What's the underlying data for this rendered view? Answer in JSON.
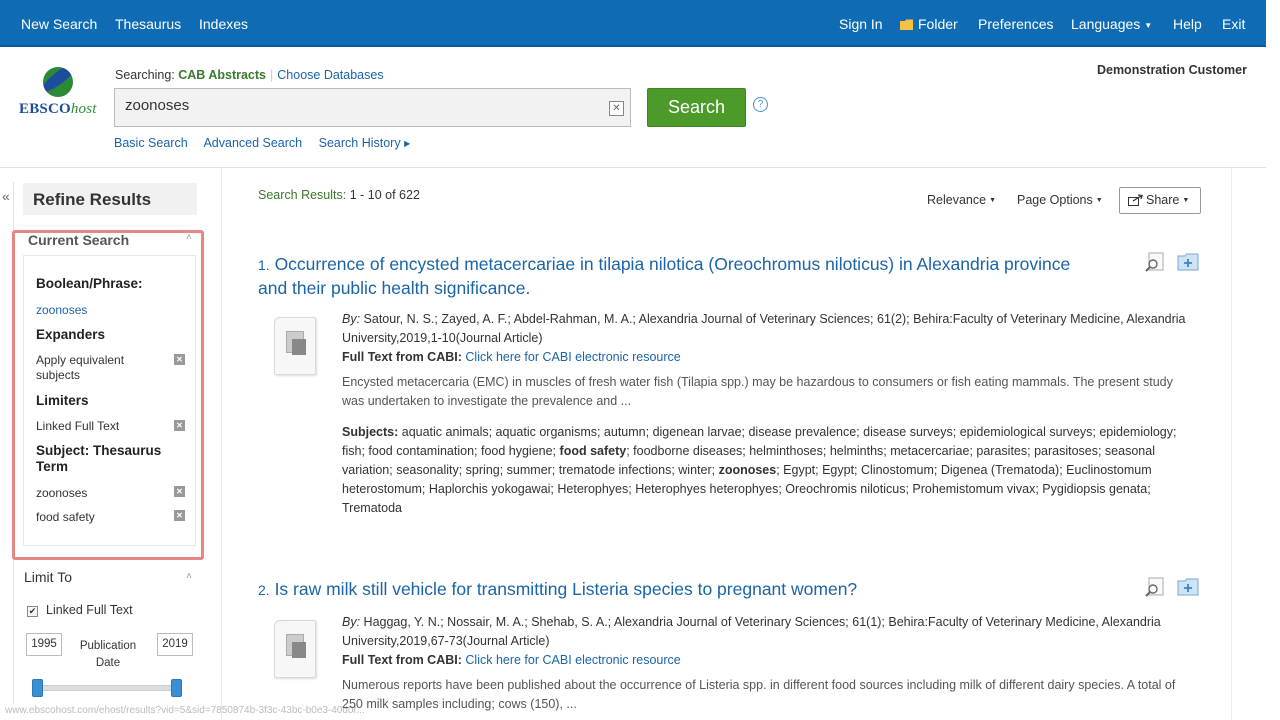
{
  "topnav": {
    "new_search": "New Search",
    "thesaurus": "Thesaurus",
    "indexes": "Indexes",
    "sign_in": "Sign In",
    "folder": "Folder",
    "preferences": "Preferences",
    "languages": "Languages",
    "help": "Help",
    "exit": "Exit"
  },
  "header": {
    "logo_main": "EBSCO",
    "logo_host": "host",
    "searching_label": "Searching:",
    "database": "CAB Abstracts",
    "choose_databases": "Choose Databases",
    "query": "zoonoses",
    "search_button": "Search",
    "help_glyph": "?",
    "basic_search": "Basic Search",
    "advanced_search": "Advanced Search",
    "search_history": "Search History",
    "customer": "Demonstration Customer"
  },
  "sidebar": {
    "refine_title": "Refine Results",
    "current_search": "Current Search",
    "boolean_label": "Boolean/Phrase:",
    "boolean_value": "zoonoses",
    "expanders_label": "Expanders",
    "expander_value": "Apply equivalent subjects",
    "limiters_label": "Limiters",
    "limiter_value": "Linked Full Text",
    "subject_label": "Subject: Thesaurus Term",
    "subject_value_1": "zoonoses",
    "subject_value_2": "food safety",
    "limit_to": "Limit To",
    "linked_full_text": "Linked Full Text",
    "linked_full_text_checked": true,
    "year_from": "1995",
    "year_to": "2019",
    "pub_date_label": "Publication Date",
    "status_url": "www.ebscohost.com/ehost/results?vid=5&sid=7850874b-3f3c-43bc-b0e3-40d0f..."
  },
  "results": {
    "count_label": "Search Results:",
    "count_value": "1 - 10 of 622",
    "relevance": "Relevance",
    "page_options": "Page Options",
    "share": "Share",
    "items": [
      {
        "num": "1.",
        "title": "Occurrence of encysted metacercariae in tilapia nilotica (Oreochromus niloticus) in Alexandria province and their public health significance.",
        "by_label": "By:",
        "byline": "Satour, N. S.; Zayed, A. F.; Abdel-Rahman, M. A.; Alexandria Journal of Veterinary Sciences; 61(2); Behira:Faculty of Veterinary Medicine, Alexandria University,2019,1-10(Journal Article)",
        "full_text_label": "Full Text from CABI:",
        "full_text_link": "Click here for CABI electronic resource",
        "abstract": "Encysted metacercaria (EMC) in muscles of fresh water fish (Tilapia spp.) may be hazardous to consumers or fish eating mammals. The present study was undertaken to investigate the prevalence and ...",
        "subjects_label": "Subjects:",
        "subjects_a": "aquatic animals; aquatic organisms; autumn; digenean larvae; disease prevalence; disease surveys; epidemiological surveys; epidemiology; fish; food contamination; food hygiene;",
        "subjects_bold1": "food safety",
        "subjects_b": "; foodborne diseases; helminthoses; helminths; metacercariae; parasites; parasitoses; seasonal variation; seasonality; spring; summer; trematode infections; winter;",
        "subjects_bold2": "zoonoses",
        "subjects_c": "; Egypt; Egypt; Clinostomum; Digenea (Trematoda); Euclinostomum heterostomum; Haplorchis yokogawai; Heterophyes; Heterophyes heterophyes; Oreochromis niloticus; Prohemistomum vivax; Pygidiopsis genata; Trematoda"
      },
      {
        "num": "2.",
        "title": "Is raw milk still vehicle for transmitting Listeria species to pregnant women?",
        "by_label": "By:",
        "byline": "Haggag, Y. N.; Nossair, M. A.; Shehab, S. A.; Alexandria Journal of Veterinary Sciences; 61(1); Behira:Faculty of Veterinary Medicine, Alexandria University,2019,67-73(Journal Article)",
        "full_text_label": "Full Text from CABI:",
        "full_text_link": "Click here for CABI electronic resource",
        "abstract": "Numerous reports have been published about the occurrence of Listeria spp. in different food sources including milk of different dairy species. A total of 250 milk samples including; cows (150), ..."
      }
    ]
  }
}
